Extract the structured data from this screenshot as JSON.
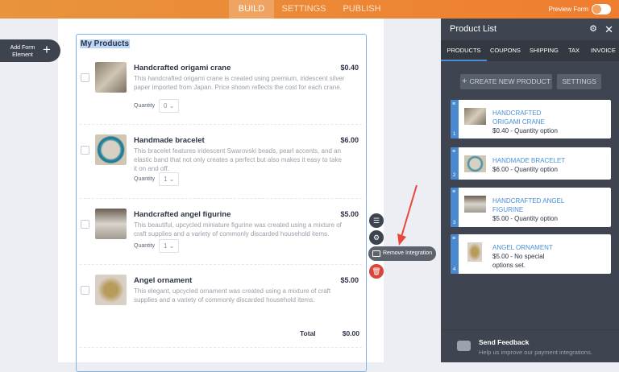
{
  "topbar": {
    "tabs": [
      "BUILD",
      "SETTINGS",
      "PUBLISH"
    ],
    "preview_label": "Preview Form"
  },
  "add_element": {
    "label": "Add Form Element",
    "icon": "plus-icon"
  },
  "form": {
    "title": "My Products",
    "quantity_label": "Quantity",
    "total_label": "Total",
    "total_value": "$0.00",
    "products": [
      {
        "name": "Handcrafted origami crane",
        "price": "$0.40",
        "description": "This handcrafted origami crane is created using premium, iridescent silver paper imported from Japan. Price shown reflects the cost for each crane.",
        "quantity": "0"
      },
      {
        "name": "Handmade bracelet",
        "price": "$6.00",
        "description": "This bracelet features iridescent Swarovski beads, pearl accents, and an elastic band that not only creates a perfect but also makes it easy to take it on and off.",
        "quantity": "1"
      },
      {
        "name": "Handcrafted angel figurine",
        "price": "$5.00",
        "description": "This beautiful, upcycled miniature figurine was created using a mixture of craft supplies and a variety of commonly discarded household items.",
        "quantity": "1"
      },
      {
        "name": "Angel ornament",
        "price": "$5.00",
        "description": "This elegant, upcycled ornament was created using a mixture of craft supplies and a variety of commonly discarded household items."
      }
    ]
  },
  "floating": {
    "remove_label": "Remove Integration"
  },
  "panel": {
    "title": "Product List",
    "tabs": [
      "PRODUCTS",
      "COUPONS",
      "SHIPPING",
      "TAX",
      "INVOICE"
    ],
    "create_label": "CREATE NEW PRODUCT",
    "settings_label": "SETTINGS",
    "cards": [
      {
        "title": "HANDCRAFTED ORIGAMI CRANE",
        "sub": "$0.40 - Quantity option",
        "num": "1"
      },
      {
        "title": "HANDMADE BRACELET",
        "sub": "$6.00 - Quantity option",
        "num": "2"
      },
      {
        "title": "HANDCRAFTED ANGEL FIGURINE",
        "sub": "$5.00 - Quantity option",
        "num": "3"
      },
      {
        "title": "ANGEL ORNAMENT",
        "sub": "$5.00 - No special options set.",
        "num": "4"
      }
    ],
    "feedback_title": "Send Feedback",
    "feedback_sub": "Help us improve our payment integrations."
  },
  "colors": {
    "accent": "#ef7d30",
    "blue": "#4a89d0",
    "panel": "#3f4550",
    "danger": "#d9453b"
  }
}
